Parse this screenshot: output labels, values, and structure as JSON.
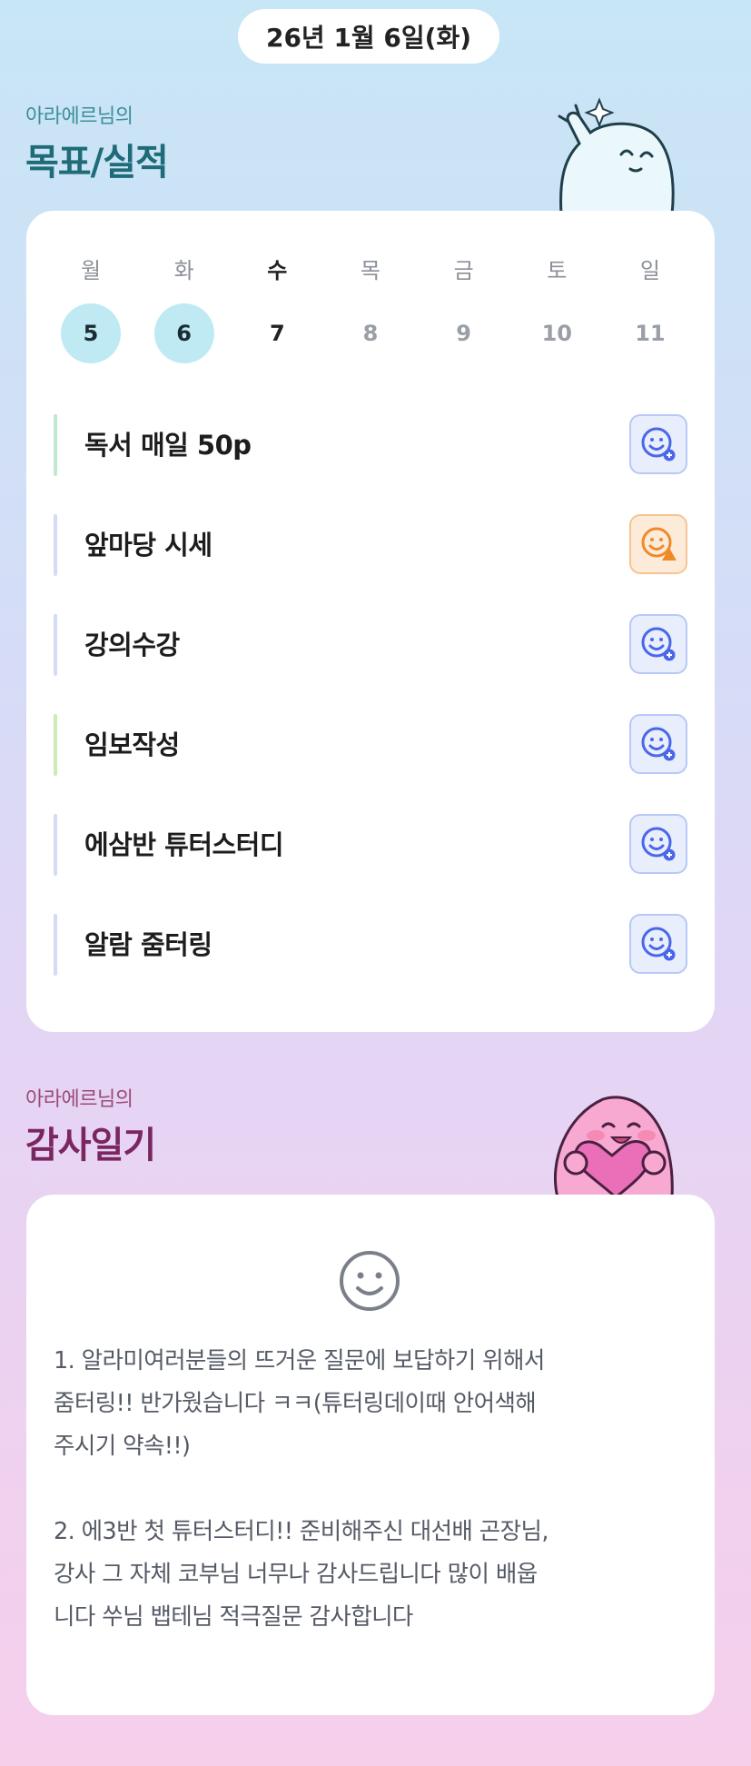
{
  "header": {
    "date": "26년 1월 6일(화)"
  },
  "goals_section": {
    "subtitle": "아라에르님의",
    "title": "목표/실적",
    "week": [
      {
        "day": "월",
        "date": "5",
        "state": "done"
      },
      {
        "day": "화",
        "date": "6",
        "state": "done"
      },
      {
        "day": "수",
        "date": "7",
        "state": "current"
      },
      {
        "day": "목",
        "date": "8",
        "state": "future"
      },
      {
        "day": "금",
        "date": "9",
        "state": "future"
      },
      {
        "day": "토",
        "date": "10",
        "state": "future"
      },
      {
        "day": "일",
        "date": "11",
        "state": "future"
      }
    ],
    "goals": [
      {
        "label": "독서 매일 50p",
        "bar_color": "#bfe8cf",
        "status": "smile-plus-icon",
        "status_color": "#4a67e8"
      },
      {
        "label": "앞마당 시세",
        "bar_color": "#d3dbf7",
        "status": "smile-warning-icon",
        "status_color": "#ef8a2b"
      },
      {
        "label": "강의수강",
        "bar_color": "#d3dbf7",
        "status": "smile-plus-icon",
        "status_color": "#4a67e8"
      },
      {
        "label": "임보작성",
        "bar_color": "#cfeab4",
        "status": "smile-plus-icon",
        "status_color": "#4a67e8"
      },
      {
        "label": "에삼반 튜터스터디",
        "bar_color": "#d3dbf7",
        "status": "smile-plus-icon",
        "status_color": "#4a67e8"
      },
      {
        "label": "알람 줌터링",
        "bar_color": "#d3dbf7",
        "status": "smile-plus-icon",
        "status_color": "#4a67e8"
      }
    ]
  },
  "gratitude_section": {
    "subtitle": "아라에르님의",
    "title": "감사일기",
    "mood_icon": "smile-face-icon",
    "entry": "1. 알라미여러분들의 뜨거운 질문에 보답하기 위해서\n줌터링!! 반가웠습니다 ㅋㅋ(튜터링데이때 안어색해\n주시기 약속!!)\n\n2. 에3반 첫 튜터스터디!! 준비해주신 대선배 곤장님,\n강사 그 자체 코부님 너무나 감사드립니다 많이 배웁\n니다  쑤님 뱁테님 적극질문 감사합니다"
  }
}
